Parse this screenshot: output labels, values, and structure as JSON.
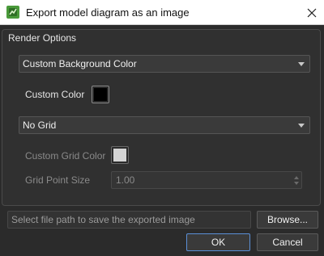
{
  "window": {
    "title": "Export model diagram as an image",
    "app_icon": "app-logo-icon",
    "close_icon": "close-icon"
  },
  "render_options": {
    "group_title": "Render Options",
    "background_select": {
      "value": "Custom Background Color"
    },
    "custom_color": {
      "label": "Custom Color",
      "color": "#000000"
    },
    "grid_select": {
      "value": "No Grid"
    },
    "custom_grid_color": {
      "label": "Custom Grid Color",
      "color": "#d4d4d4"
    },
    "grid_point_size": {
      "label": "Grid Point Size",
      "value": "1.00"
    }
  },
  "file": {
    "placeholder": "Select file path to save the exported image",
    "browse_label": "Browse..."
  },
  "buttons": {
    "ok": "OK",
    "cancel": "Cancel"
  },
  "colors": {
    "accent": "#5b8fd6",
    "icon_green": "#4a9a3a"
  }
}
